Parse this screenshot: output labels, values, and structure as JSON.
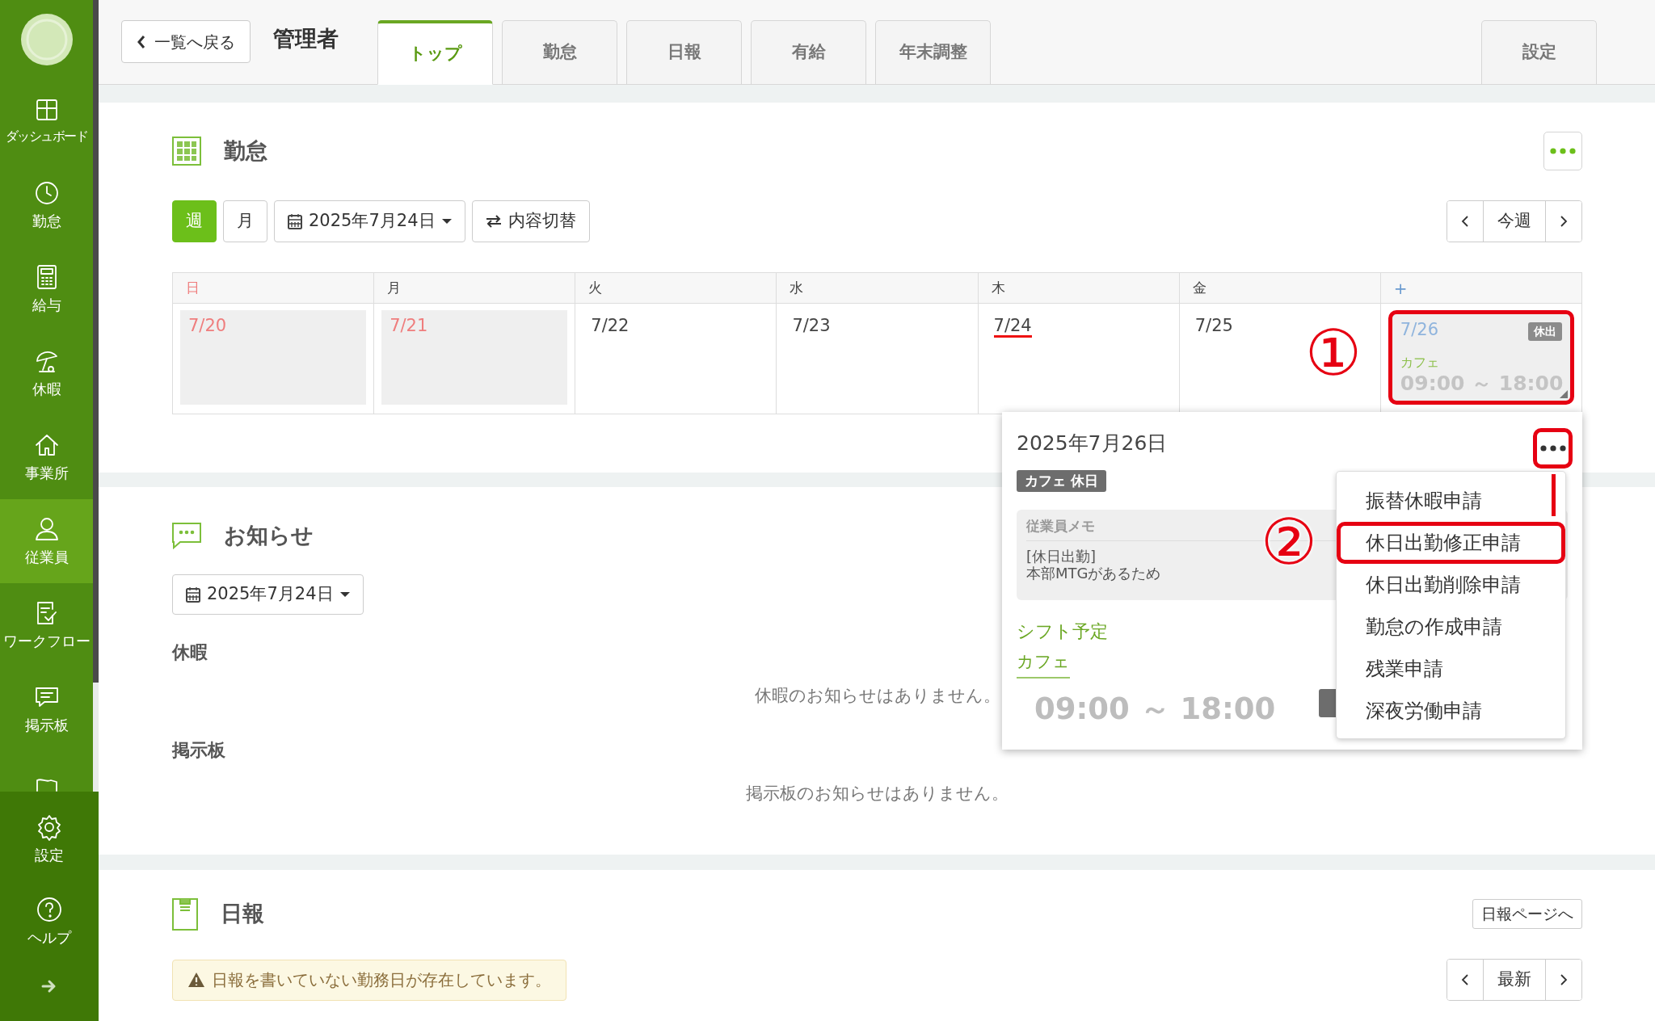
{
  "sidebar": {
    "items": [
      {
        "label": "ダッシュボード",
        "selected": false
      },
      {
        "label": "勤怠",
        "selected": false
      },
      {
        "label": "給与",
        "selected": false
      },
      {
        "label": "休暇",
        "selected": false
      },
      {
        "label": "事業所",
        "selected": false
      },
      {
        "label": "従業員",
        "selected": true
      },
      {
        "label": "ワークフロー",
        "selected": false
      },
      {
        "label": "掲示板",
        "selected": false
      }
    ],
    "bottom_items": [
      {
        "label": "設定"
      },
      {
        "label": "ヘルプ"
      }
    ]
  },
  "header": {
    "back_button": "一覧へ戻る",
    "title": "管理者",
    "tabs": [
      {
        "label": "トップ",
        "selected": true
      },
      {
        "label": "勤怠",
        "selected": false
      },
      {
        "label": "日報",
        "selected": false
      },
      {
        "label": "有給",
        "selected": false
      },
      {
        "label": "年末調整",
        "selected": false
      }
    ],
    "settings_tab": "設定"
  },
  "attendance": {
    "title": "勤怠",
    "view_buttons": [
      {
        "label": "週",
        "selected": true
      },
      {
        "label": "月",
        "selected": false
      }
    ],
    "date_picker": "2025年7月24日",
    "toggle_button": "内容切替",
    "pager_label": "今週",
    "calendar": {
      "columns": [
        {
          "label": "日",
          "kind": "sunday"
        },
        {
          "label": "月",
          "kind": "weekday"
        },
        {
          "label": "火",
          "kind": "weekday"
        },
        {
          "label": "水",
          "kind": "weekday"
        },
        {
          "label": "木",
          "kind": "weekday"
        },
        {
          "label": "金",
          "kind": "weekday"
        },
        {
          "label": "+",
          "kind": "add"
        }
      ],
      "days": [
        {
          "date": "7/20",
          "kind": "holiday",
          "today": false,
          "highlighted": false
        },
        {
          "date": "7/21",
          "kind": "holiday",
          "today": false,
          "highlighted": false
        },
        {
          "date": "7/22",
          "kind": "workday",
          "today": false,
          "highlighted": false
        },
        {
          "date": "7/23",
          "kind": "workday",
          "today": false,
          "highlighted": false
        },
        {
          "date": "7/24",
          "kind": "workday",
          "today": true,
          "highlighted": false
        },
        {
          "date": "7/25",
          "kind": "workday",
          "today": false,
          "highlighted": false
        },
        {
          "date": "7/26",
          "kind": "shift",
          "today": false,
          "highlighted": true,
          "badge": "休出",
          "shift_name": "カフェ",
          "time": "09:00 ～ 18:00"
        }
      ]
    }
  },
  "popup": {
    "date": "2025年7月26日",
    "tag": "カフェ 休日",
    "memo_label": "従業員メモ",
    "memo_lines": [
      "[休日出勤]",
      "本部MTGがあるため"
    ],
    "shift_heading": "シフト予定",
    "shift_name": "カフェ",
    "time": "09:00 ～ 18:00",
    "more_highlighted": true,
    "menu": [
      {
        "label": "振替休暇申請",
        "highlighted": false
      },
      {
        "label": "休日出勤修正申請",
        "highlighted": true
      },
      {
        "label": "休日出勤削除申請",
        "highlighted": false
      },
      {
        "label": "勤怠の作成申請",
        "highlighted": false
      },
      {
        "label": "残業申請",
        "highlighted": false
      },
      {
        "label": "深夜労働申請",
        "highlighted": false
      }
    ]
  },
  "annotations": [
    "①",
    "②"
  ],
  "notices": {
    "title": "お知らせ",
    "date_picker": "2025年7月24日",
    "groups": [
      {
        "title": "休暇",
        "empty_text": "休暇のお知らせはありません。"
      },
      {
        "title": "掲示板",
        "empty_text": "掲示板のお知らせはありません。"
      }
    ]
  },
  "daily_report": {
    "title": "日報",
    "link_button": "日報ページへ",
    "warning": "日報を書いていない勤務日が存在しています。",
    "pager_label": "最新"
  }
}
